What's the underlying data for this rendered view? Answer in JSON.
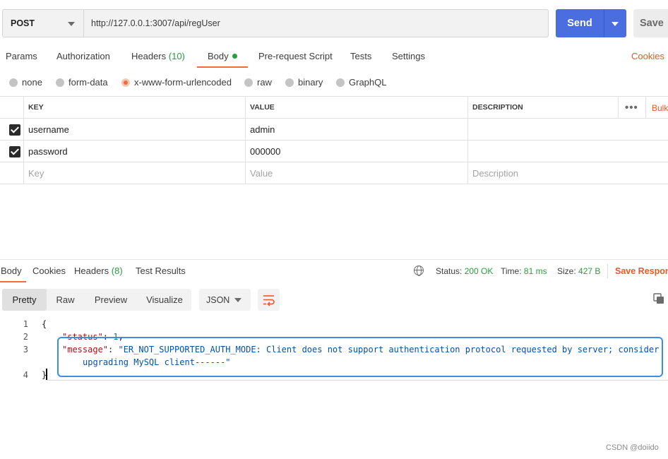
{
  "request": {
    "method": "POST",
    "url": "http://127.0.0.1:3007/api/regUser",
    "send_label": "Send",
    "save_label": "Save"
  },
  "request_tabs": {
    "params": "Params",
    "authorization": "Authorization",
    "headers": "Headers",
    "headers_count": "(10)",
    "body": "Body",
    "prerequest": "Pre-request Script",
    "tests": "Tests",
    "settings": "Settings",
    "cookies": "Cookies",
    "active": "Body"
  },
  "body_types": {
    "none": "none",
    "form_data": "form-data",
    "urlencoded": "x-www-form-urlencoded",
    "raw": "raw",
    "binary": "binary",
    "graphql": "GraphQL",
    "selected": "x-www-form-urlencoded"
  },
  "params_table": {
    "headers": {
      "key": "KEY",
      "value": "VALUE",
      "description": "DESCRIPTION",
      "bulk": "Bulk"
    },
    "rows": [
      {
        "checked": true,
        "key": "username",
        "value": "admin",
        "description": ""
      },
      {
        "checked": true,
        "key": "password",
        "value": "000000",
        "description": ""
      }
    ],
    "placeholder": {
      "key": "Key",
      "value": "Value",
      "description": "Description"
    }
  },
  "response_tabs": {
    "body": "Body",
    "cookies": "Cookies",
    "headers": "Headers",
    "headers_count": "(8)",
    "test_results": "Test Results",
    "active": "Body"
  },
  "response_status": {
    "status_label": "Status:",
    "status_value": "200 OK",
    "time_label": "Time:",
    "time_value": "81 ms",
    "size_label": "Size:",
    "size_value": "427 B",
    "save_response": "Save Response"
  },
  "view_modes": {
    "pretty": "Pretty",
    "raw": "Raw",
    "preview": "Preview",
    "visualize": "Visualize",
    "active": "Pretty",
    "format": "JSON"
  },
  "response_body": {
    "line_numbers": [
      "1",
      "2",
      "3",
      "4"
    ],
    "open_brace": "{",
    "status_key": "\"status\"",
    "status_value": "1",
    "message_key": "\"message\"",
    "message_value_line1": "\"ER_NOT_SUPPORTED_AUTH_MODE: Client does not support authentication protocol requested by server; consider",
    "message_value_line2": "upgrading MySQL client------\"",
    "close_brace": "}"
  },
  "colors": {
    "accent_orange": "#f26b3a",
    "send_blue": "#4a6ee0",
    "success_green": "#26a03a",
    "highlight_blue": "#3b8ee6"
  },
  "watermark": "CSDN @doiido"
}
